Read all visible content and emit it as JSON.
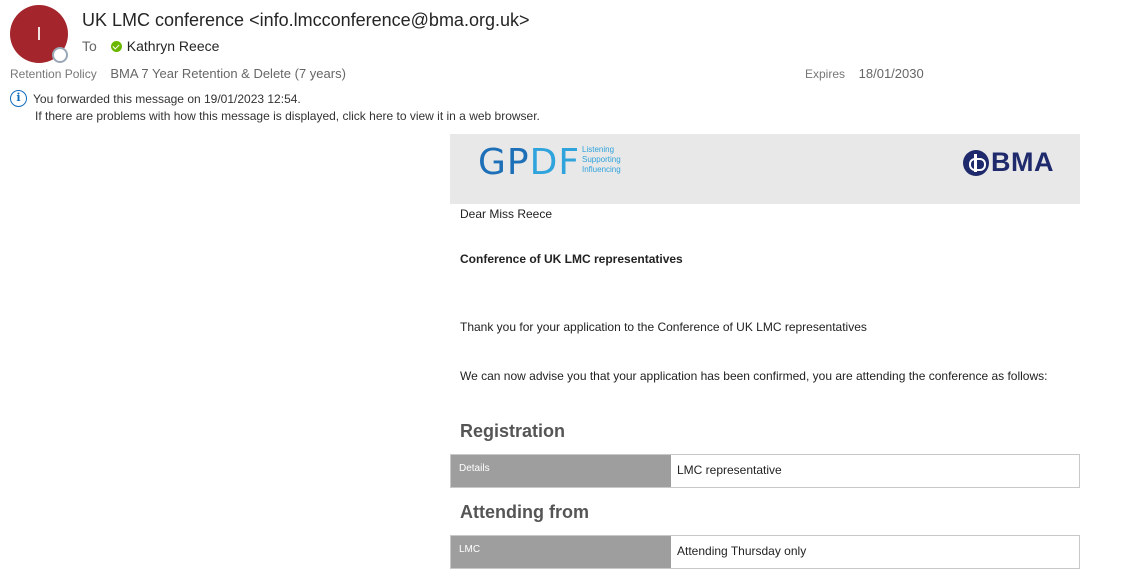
{
  "header": {
    "avatar_initial": "I",
    "sender": "UK LMC conference <info.lmcconference@bma.org.uk>",
    "to_label": "To",
    "recipient": "Kathryn Reece",
    "retention_label": "Retention Policy",
    "retention_value": "BMA 7 Year Retention & Delete (7 years)",
    "expires_label": "Expires",
    "expires_value": "18/01/2030",
    "forward_notice": "You forwarded this message on 19/01/2023 12:54.",
    "display_notice": "If there are problems with how this message is displayed, click here to view it in a web browser."
  },
  "banner": {
    "gpdf_main": "GP",
    "gpdf_accent": "DF",
    "tagline": [
      "Listening",
      "Supporting",
      "Influencing"
    ],
    "bma_text": "BMA"
  },
  "body": {
    "salutation": "Dear Miss Reece",
    "conference_title": "Conference of UK LMC representatives",
    "thanks": "Thank you for your application to the Conference of UK LMC representatives",
    "advise": "We can now advise you that your application has been confirmed, you are attending the conference as follows:"
  },
  "registration": {
    "heading": "Registration",
    "key": "Details",
    "value": "LMC representative"
  },
  "attending": {
    "heading": "Attending from",
    "key": "LMC",
    "value": "Attending Thursday only"
  },
  "colors": {
    "avatar": "#a4262c",
    "presence_ok": "#6bb700",
    "info_blue": "#0f6cbd",
    "gpdf_blue": "#1d6fb8",
    "gpdf_light": "#2fa3dc",
    "bma_navy": "#1e2a6b"
  }
}
